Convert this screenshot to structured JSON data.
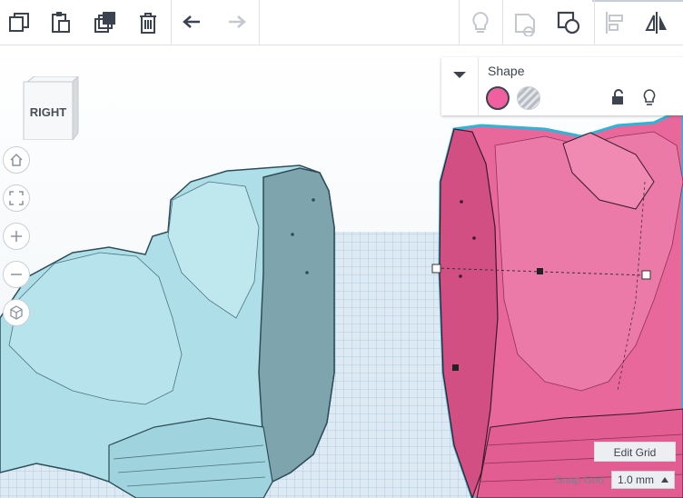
{
  "toolbar": {
    "icons": [
      "copy-icon",
      "paste-icon",
      "duplicate-icon",
      "delete-icon",
      "undo-icon",
      "redo-icon",
      "show-all-icon",
      "hide-icon",
      "group-icon",
      "align-icon",
      "mirror-icon"
    ]
  },
  "viewcube": {
    "face_label": "RIGHT"
  },
  "nav": {
    "icons": [
      "home-view-icon",
      "fit-view-icon",
      "zoom-in-icon",
      "zoom-out-icon",
      "projection-icon"
    ]
  },
  "inspector": {
    "title": "Shape",
    "solid_color": "#f0609e",
    "hole_label_icon": "hole-pattern-icon"
  },
  "grid": {
    "edit_label": "Edit Grid",
    "snap_label": "Snap Grid",
    "snap_value": "1.0 mm"
  },
  "colors": {
    "left_shape": "#a8dde6",
    "right_shape": "#e7679a",
    "selection_outline": "#2bb5d6",
    "workplane": "#ddeaf4"
  }
}
